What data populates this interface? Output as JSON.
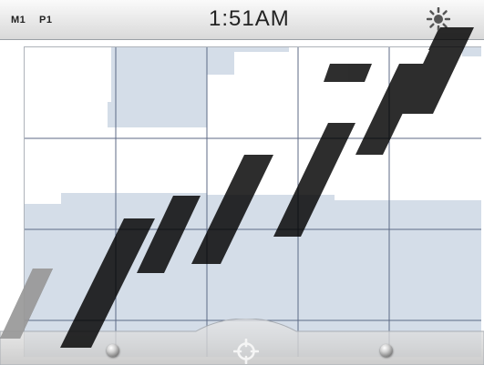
{
  "status_bar": {
    "mode_label": "M1",
    "page_label": "P1",
    "time": "1:51AM",
    "brightness_icon": "sun-icon"
  },
  "bottom_bar": {
    "left_slider_icon": "slider-knob-icon",
    "center_icon": "crosshair-locate-icon",
    "right_slider_icon": "slider-knob-icon"
  },
  "colors": {
    "map_fill": "#d4dde8",
    "grid_line": "#5d6a86",
    "bar_gradient_top": "#fafafa",
    "bar_gradient_bottom": "#d9d9d9"
  }
}
